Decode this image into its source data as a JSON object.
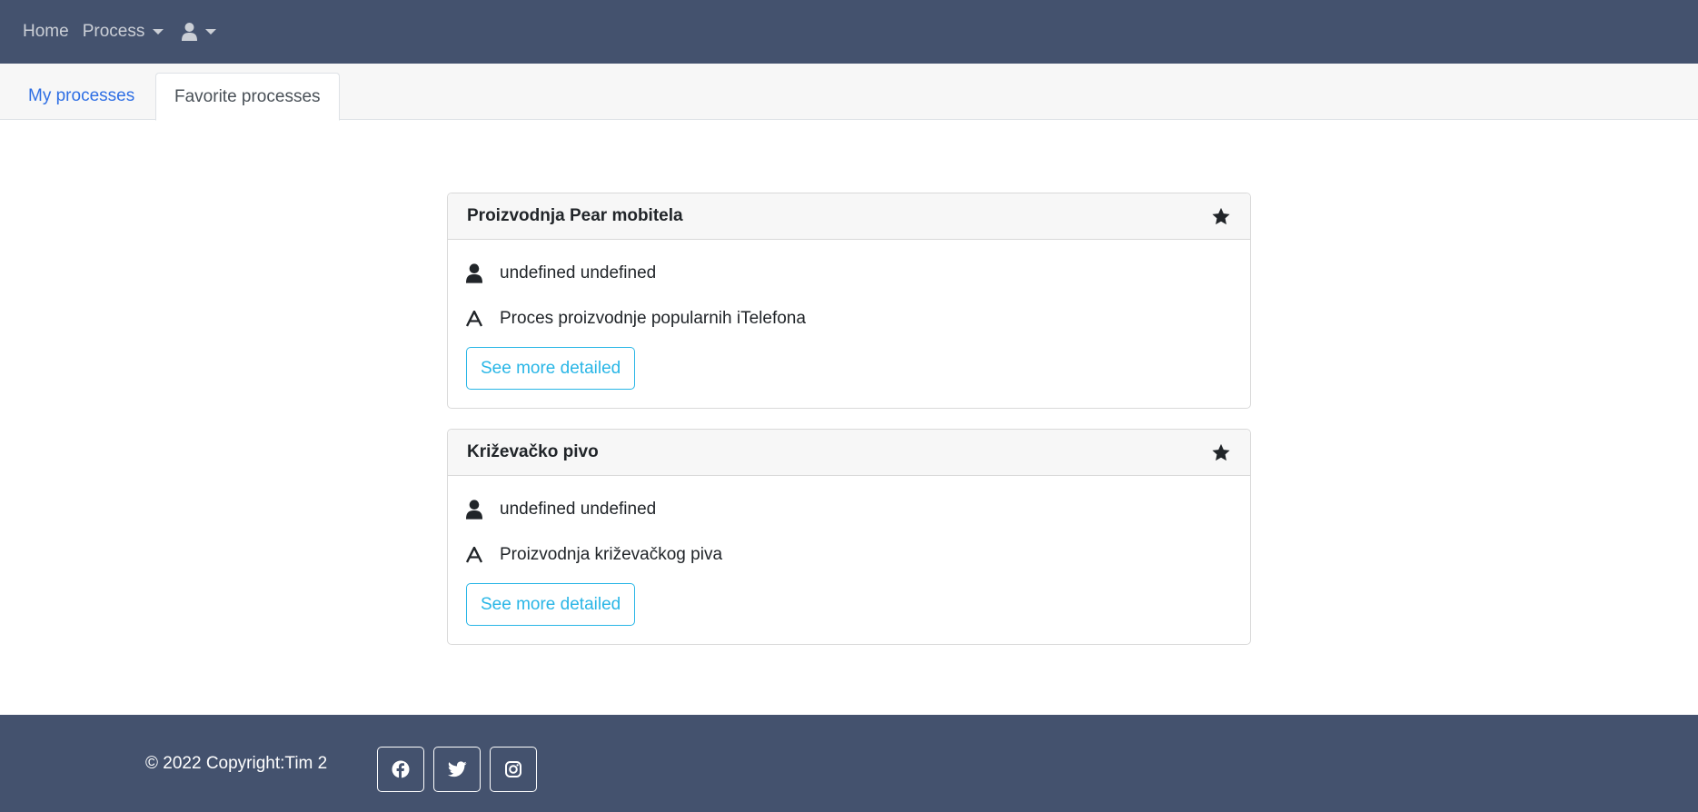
{
  "navbar": {
    "home_label": "Home",
    "process_label": "Process",
    "user_icon": "user-icon"
  },
  "tabs": [
    {
      "label": "My processes",
      "active": false
    },
    {
      "label": "Favorite processes",
      "active": true
    }
  ],
  "cards": [
    {
      "title": "Proizvodnja Pear mobitela",
      "favorite_icon": "star-icon",
      "owner": "undefined undefined",
      "description": "Proces proizvodnje popularnih iTelefona",
      "button_label": "See more detailed"
    },
    {
      "title": "Križevačko pivo",
      "favorite_icon": "star-icon",
      "owner": "undefined undefined",
      "description": "Proizvodnja križevačkog piva",
      "button_label": "See more detailed"
    }
  ],
  "footer": {
    "copyright": "© 2022 Copyright:Tim 2",
    "social": [
      "facebook-icon",
      "twitter-icon",
      "instagram-icon"
    ]
  },
  "colors": {
    "nav_bg": "#44526e",
    "link": "#2f6fe4",
    "info": "#29b6e6"
  }
}
